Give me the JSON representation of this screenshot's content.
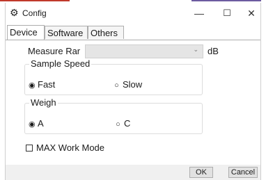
{
  "window": {
    "title": "Config",
    "icon": "gear-icon",
    "minimize_glyph": "—",
    "maximize_glyph": "☐",
    "close_glyph": "✕"
  },
  "tabs": [
    {
      "label": "Device",
      "selected": true
    },
    {
      "label": "Software",
      "selected": false
    },
    {
      "label": "Others",
      "selected": false
    }
  ],
  "device": {
    "measure": {
      "label": "Measure Rar",
      "value": "",
      "unit": "dB"
    },
    "sample_speed": {
      "legend": "Sample Speed",
      "options": [
        {
          "label": "Fast",
          "selected": true
        },
        {
          "label": "Slow",
          "selected": false
        }
      ]
    },
    "weigh": {
      "legend": "Weigh",
      "options": [
        {
          "label": "A",
          "selected": true
        },
        {
          "label": "C",
          "selected": false
        }
      ]
    },
    "max_work_mode": {
      "label": "MAX Work Mode",
      "checked": false
    }
  },
  "footer": {
    "ok_label": "OK",
    "cancel_label": "Cancel"
  },
  "colors": {
    "accent_left": "#c0392b",
    "accent_right": "#6d5ba0",
    "select_bg": "#e5e5e5"
  }
}
